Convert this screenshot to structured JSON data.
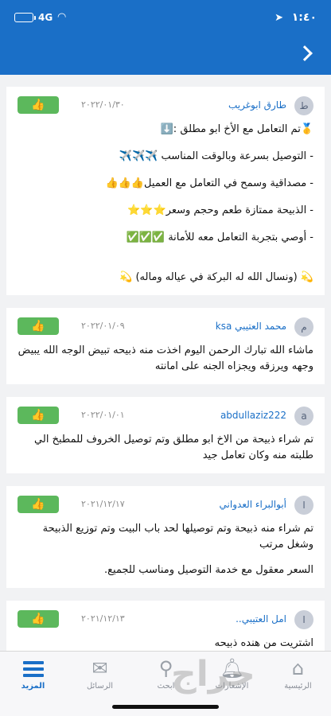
{
  "status": {
    "time": "١:٤٠",
    "network": "4G",
    "location_icon": "location-arrow-icon",
    "wifi_icon": "wifi-icon",
    "battery_color": "#ffe033"
  },
  "nav": {
    "back_icon": "chevron-right-icon"
  },
  "comments": [
    {
      "avatar": "ط",
      "author": "طارق ابوغريب",
      "date": "٢٠٢٢/٠١/٣٠",
      "lines": [
        "🥇تم التعامل مع الأخ ابو مطلق :⬇️",
        "- التوصيل بسرعة وبالوقت المناسب ✈️✈️✈️",
        "- مصداقية وسمح في التعامل مع العميل👍👍👍",
        "- الذبيحة ممتازة طعم وحجم وسعر⭐️⭐️⭐️",
        "- أوصي بتجربة التعامل معه للأمانة ✅✅✅",
        "💫 (ونسال الله له البركة في عياله وماله) 💫"
      ]
    },
    {
      "avatar": "م",
      "author": "محمد العتيبي ksa",
      "date": "٢٠٢٢/٠١/٠٩",
      "lines": [
        "ماشاء الله تبارك الرحمن اليوم اخذت منه ذبيحه تبيض الوجه الله يبيض وجهه ويرزقه ويجزاه الجنه على امانته"
      ]
    },
    {
      "avatar": "a",
      "author": "abdullaziz222",
      "date": "٢٠٢٢/٠١/٠١",
      "lines": [
        "تم شراء ذبيحة من الاخ ابو مطلق وتم توصيل الخروف للمطبخ الي طلبته منه وكان تعامل جيد"
      ]
    },
    {
      "avatar": "ا",
      "author": "أبوالبراء العدواني",
      "date": "٢٠٢١/١٢/١٧",
      "lines": [
        "تم شراء منه ذبيحة وتم توصيلها لحد باب البيت وتم توزيع الذبيحة وشغل مرتب",
        "السعر معقول مع خدمة التوصيل ومناسب للجميع."
      ]
    },
    {
      "avatar": "ا",
      "author": "امل العتيبي..",
      "date": "٢٠٢١/١٢/١٣",
      "lines": [
        "اشتريت من هنده ذبيحه"
      ]
    }
  ],
  "like_icon": "thumbs-up-icon",
  "tabs": [
    {
      "label": "الرئيسية",
      "icon": "home-icon"
    },
    {
      "label": "الإشعارات",
      "icon": "bell-icon"
    },
    {
      "label": "ابحث",
      "icon": "search-icon"
    },
    {
      "label": "الرسائل",
      "icon": "envelope-icon"
    },
    {
      "label": "المزيد",
      "icon": "menu-icon"
    }
  ],
  "watermark": "حراج"
}
